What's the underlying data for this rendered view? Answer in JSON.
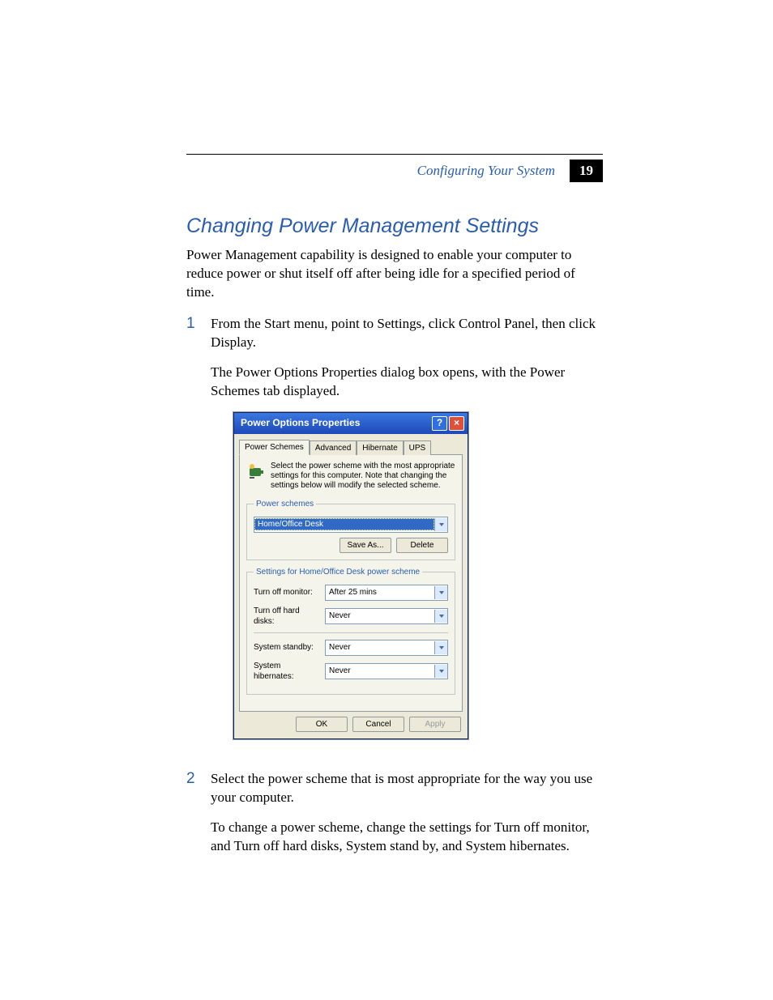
{
  "header": {
    "section": "Configuring Your System",
    "page_number": "19"
  },
  "title": "Changing Power Management Settings",
  "intro": "Power Management capability is designed to enable your computer to reduce power or shut itself off after being idle for a specified period of time.",
  "steps": [
    {
      "num": "1",
      "p1": "From the Start menu, point to Settings, click Control Panel, then click Display.",
      "p2": "The Power Options Properties dialog box opens, with the Power Schemes tab displayed."
    },
    {
      "num": "2",
      "p1": "Select the power scheme that is most appropriate for the way you use your computer.",
      "p2": "To change a power scheme, change the settings for Turn off monitor, and Turn off hard disks, System stand by, and System hibernates."
    }
  ],
  "dialog": {
    "title": "Power Options Properties",
    "tabs": [
      "Power Schemes",
      "Advanced",
      "Hibernate",
      "UPS"
    ],
    "hint": "Select the power scheme with the most appropriate settings for this computer. Note that changing the settings below will modify the selected scheme.",
    "fieldset1_legend": "Power schemes",
    "scheme_value": "Home/Office Desk",
    "save_as_label": "Save As...",
    "delete_label": "Delete",
    "fieldset2_legend": "Settings for Home/Office Desk power scheme",
    "settings": [
      {
        "label": "Turn off monitor:",
        "value": "After 25 mins"
      },
      {
        "label": "Turn off hard disks:",
        "value": "Never"
      },
      {
        "label": "System standby:",
        "value": "Never"
      },
      {
        "label": "System hibernates:",
        "value": "Never"
      }
    ],
    "ok_label": "OK",
    "cancel_label": "Cancel",
    "apply_label": "Apply"
  }
}
